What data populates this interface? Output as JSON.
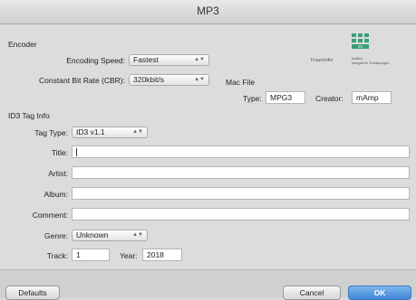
{
  "window": {
    "title": "MP3"
  },
  "encoder": {
    "section_label": "Encoder",
    "speed_label": "Encoding Speed:",
    "speed_value": "Fastest",
    "cbr_label": "Constant Bit Rate (CBR):",
    "cbr_value": "320kbit/s"
  },
  "mac_file": {
    "section_label": "Mac File",
    "type_label": "Type:",
    "type_value": "MPG3",
    "creator_label": "Creator:",
    "creator_value": "mAmp"
  },
  "logo": {
    "name": "Fraunhofer",
    "abbr": "IIS",
    "line1": "Institut",
    "line2": "Integrierte Schaltungen"
  },
  "id3": {
    "section_label": "ID3 Tag Info",
    "tag_type_label": "Tag Type:",
    "tag_type_value": "ID3 v1.1",
    "title_label": "Title:",
    "title_value": "",
    "artist_label": "Artist:",
    "artist_value": "",
    "album_label": "Album:",
    "album_value": "",
    "comment_label": "Comment:",
    "comment_value": "",
    "genre_label": "Genre:",
    "genre_value": "Unknown",
    "track_label": "Track:",
    "track_value": "1",
    "year_label": "Year:",
    "year_value": "2018"
  },
  "buttons": {
    "defaults": "Defaults",
    "cancel": "Cancel",
    "ok": "OK"
  },
  "colors": {
    "ok_button": "#3f86d8",
    "logo": "#3a9e78"
  }
}
